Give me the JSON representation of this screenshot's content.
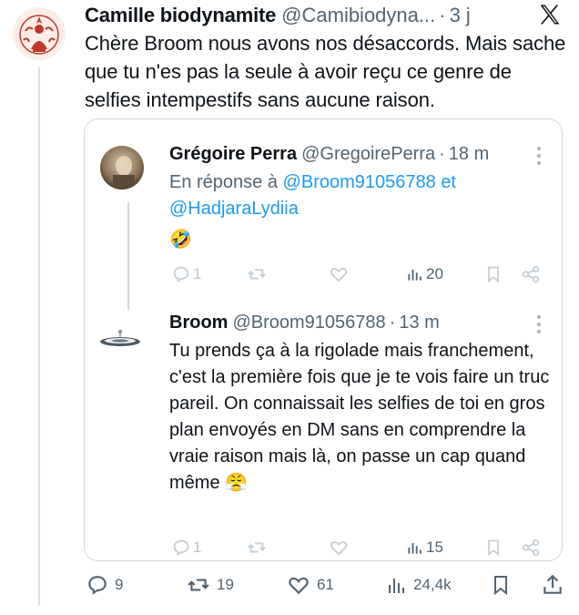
{
  "main_tweet": {
    "author_name": "Camille biodynamite",
    "author_handle": "@Camibiodyna...",
    "dot": "·",
    "time": "3 j",
    "text": "Chère Broom nous avons nos désaccords. Mais sache que tu n'es pas la seule à avoir reçu ce genre de selfies intempestifs sans aucune raison."
  },
  "quote": {
    "first": {
      "author_name": "Grégoire Perra",
      "author_handle": "@GregoirePerra",
      "dot": "·",
      "time": "18 m",
      "reply_prefix": "En réponse à",
      "mention_1": "@Broom91056788",
      "and_word": "et",
      "mention_2": "@HadjaraLydiia",
      "emoji": "🤣",
      "stats": {
        "replies": "1",
        "retweets": "",
        "likes": "",
        "views": "20"
      }
    },
    "second": {
      "author_name": "Broom",
      "author_handle": "@Broom91056788",
      "dot": "·",
      "time": "13 m",
      "text": "Tu prends ça à la rigolade mais franchement, c'est la première fois que je te vois faire un truc pareil. On connaissait les selfies de toi en gros plan envoyés en DM sans en comprendre la vraie raison mais là, on passe un cap quand même",
      "emoji": "😤",
      "stats": {
        "replies": "1",
        "retweets": "",
        "likes": "",
        "views": "15"
      }
    }
  },
  "actions": {
    "replies": "9",
    "retweets": "19",
    "likes": "61",
    "views": "24,4k"
  },
  "icons": [
    "x-logo-icon",
    "more-icon",
    "reply-icon",
    "retweet-icon",
    "like-icon",
    "views-icon",
    "bookmark-icon",
    "share-icon"
  ],
  "colors": {
    "text": "#0f1419",
    "secondary": "#536471",
    "mention": "#1d9bf0",
    "border": "#cfd9de"
  }
}
